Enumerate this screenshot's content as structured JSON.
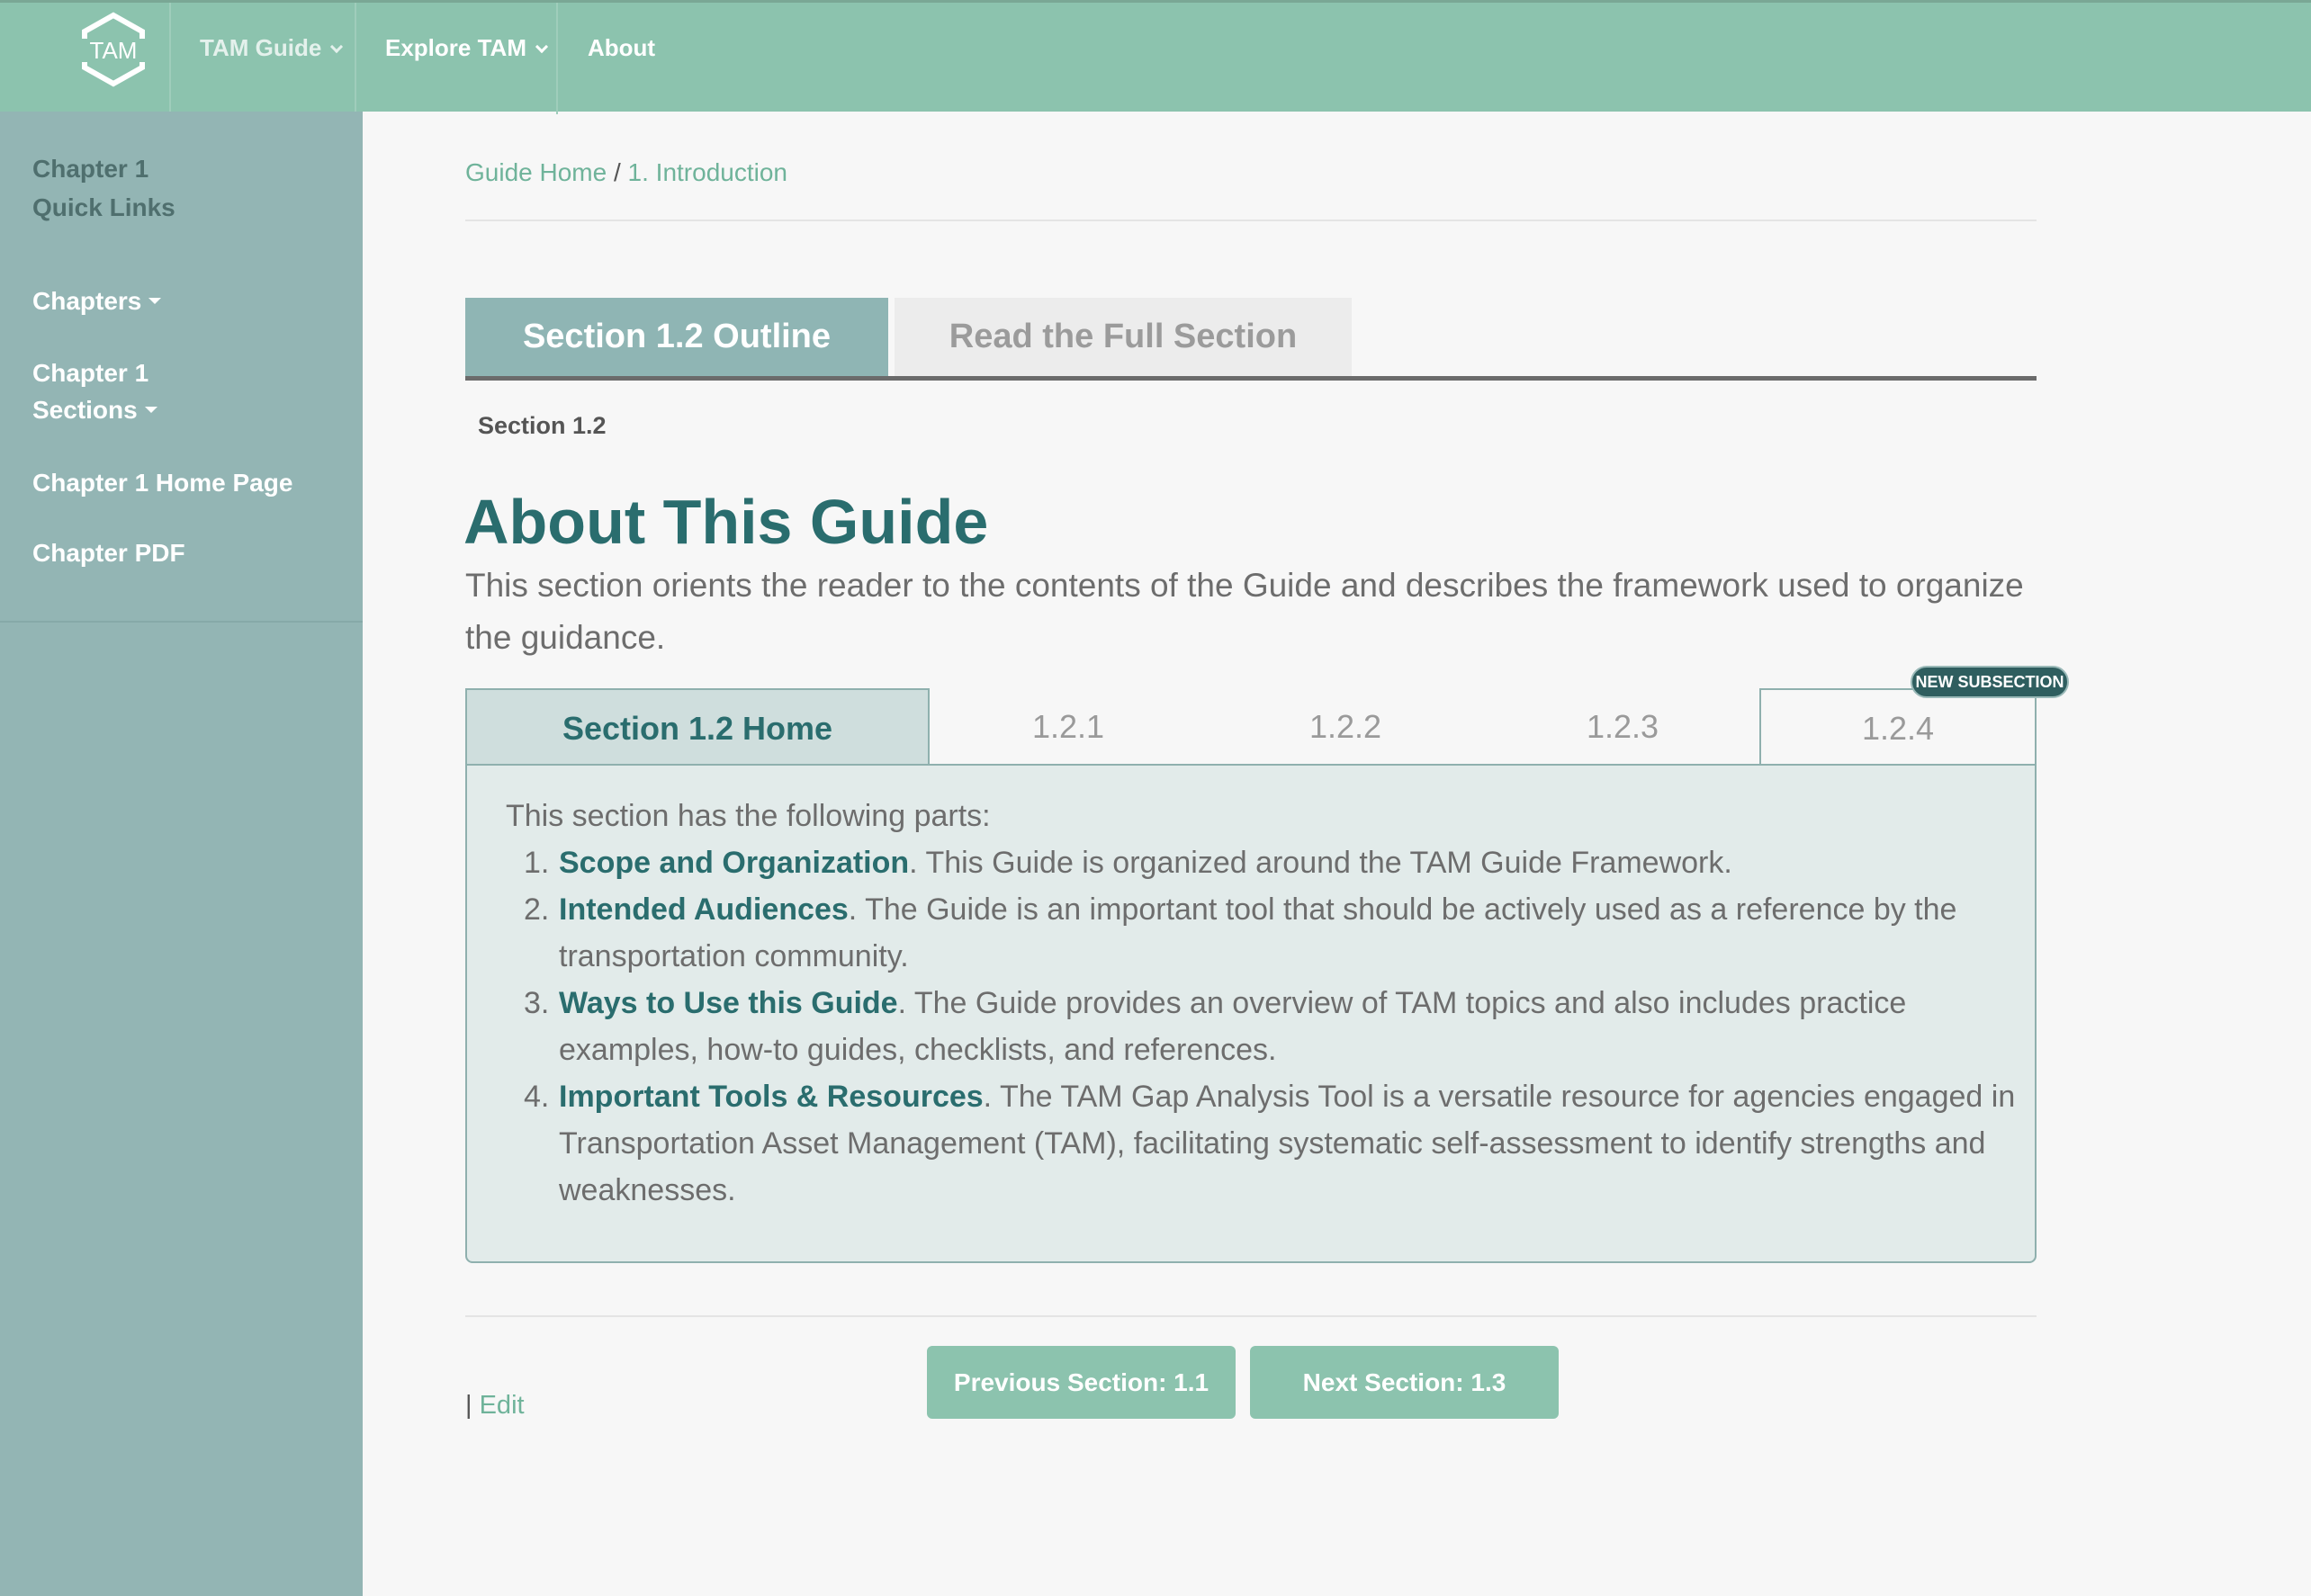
{
  "nav": {
    "logo_text": "TAM",
    "items": [
      {
        "label": "TAM Guide"
      },
      {
        "label": "Explore TAM"
      },
      {
        "label": "About"
      }
    ]
  },
  "sidebar": {
    "heading_line1": "Chapter 1",
    "heading_line2": "Quick Links",
    "chapters": "Chapters",
    "sections_line1": "Chapter 1",
    "sections_line2": "Sections",
    "home_page": "Chapter 1 Home Page",
    "pdf": "Chapter PDF"
  },
  "breadcrumb": {
    "home": "Guide Home",
    "separator": " / ",
    "current": "1. Introduction"
  },
  "view_tabs": {
    "outline": "Section 1.2 Outline",
    "full": "Read the Full Section"
  },
  "section_label": "Section 1.2",
  "title": "About This Guide",
  "lead": "This section orients the reader to the contents of the Guide and describes the framework used to organize the guidance.",
  "subsection_tabs": {
    "home": "Section 1.2 Home",
    "t1": "1.2.1",
    "t2": "1.2.2",
    "t3": "1.2.3",
    "t4": "1.2.4",
    "badge": "NEW SUBSECTION"
  },
  "panel": {
    "intro": "This section has the following parts:",
    "parts": [
      {
        "num": "1.",
        "title": "Scope and Organization",
        "text": ". This Guide is organized around the TAM Guide Framework."
      },
      {
        "num": "2.",
        "title": "Intended Audiences",
        "text": ". The Guide is an important tool that should be actively used as a reference by the transportation community."
      },
      {
        "num": "3.",
        "title": "Ways to Use this Guide",
        "text": ". The Guide provides an overview of TAM topics and also includes practice examples, how-to guides, checklists, and references."
      },
      {
        "num": "4.",
        "title": "Important Tools & Resources",
        "text": ". The TAM Gap Analysis Tool is a versatile resource for agencies engaged in Transportation Asset Management (TAM), facilitating systematic self-assessment to identify strengths and weaknesses."
      }
    ]
  },
  "footer": {
    "edit_prefix": "| ",
    "edit": "Edit",
    "prev": "Previous Section: 1.1",
    "next": "Next Section: 1.3"
  },
  "colors": {
    "nav": "#8cc3ae",
    "sidebar": "#93b5b4",
    "accent_dark": "#2a6d6e",
    "link": "#6fb39a"
  }
}
